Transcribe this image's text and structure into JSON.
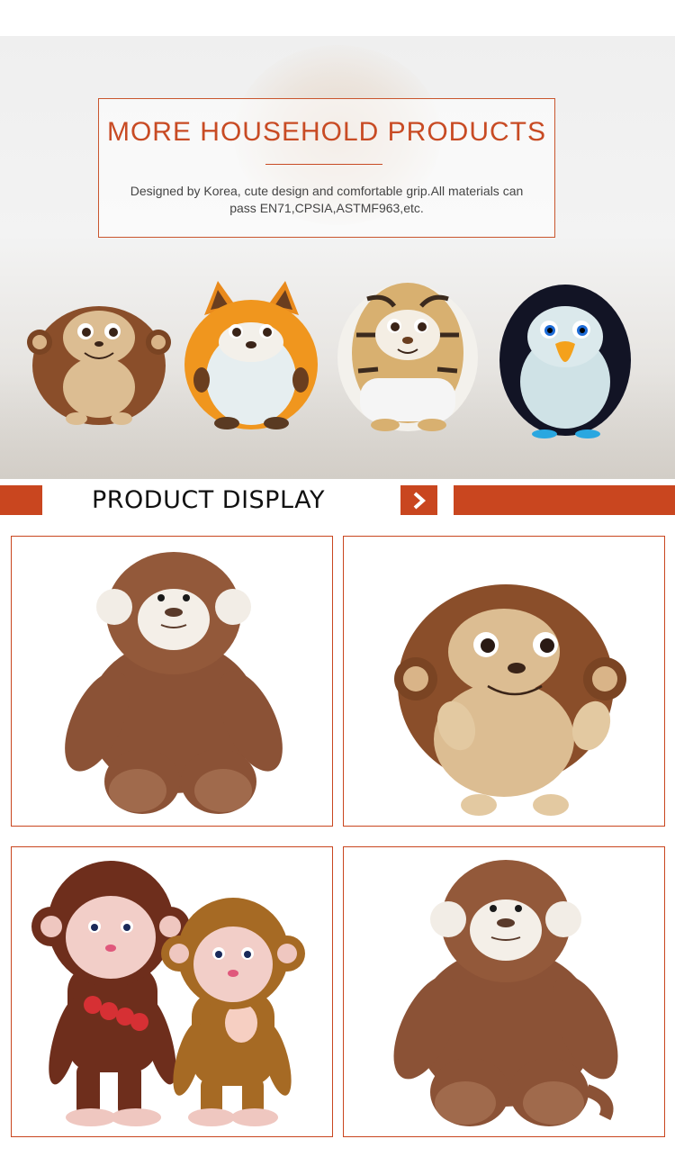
{
  "hero": {
    "title": "MORE HOUSEHOLD PRODUCTS",
    "description": "Designed by Korea, cute design and comfortable grip.All materials can pass EN71,CPSIA,ASTMF963,etc.",
    "toys": [
      "monkey-plush-icon",
      "fox-plush-icon",
      "tiger-plush-icon",
      "penguin-plush-icon"
    ]
  },
  "section": {
    "title": "PRODUCT DISPLAY",
    "arrow_icon": "chevron-right-icon"
  },
  "products": [
    {
      "icon": "monkey-plush-icon"
    },
    {
      "icon": "round-monkey-plush-icon"
    },
    {
      "icon": "monkey-pair-plush-icon"
    },
    {
      "icon": "monkey-plush-icon"
    }
  ],
  "colors": {
    "accent": "#c9461f",
    "title": "#c84b24"
  }
}
